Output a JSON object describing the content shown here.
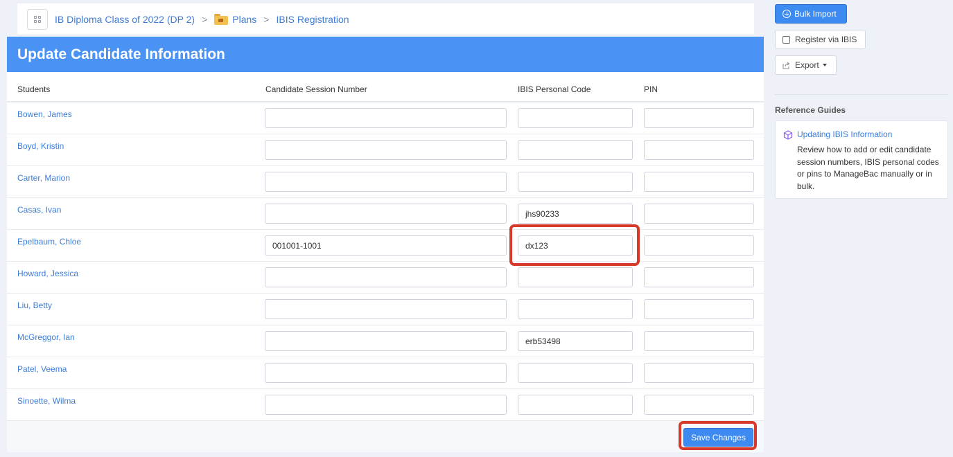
{
  "breadcrumb": {
    "class_name": "IB Diploma Class of 2022 (DP 2)",
    "plans": "Plans",
    "current": "IBIS Registration",
    "separator": ">"
  },
  "panel": {
    "title": "Update Candidate Information",
    "columns": {
      "students": "Students",
      "session": "Candidate Session Number",
      "ibis": "IBIS Personal Code",
      "pin": "PIN"
    },
    "rows": [
      {
        "name": "Bowen, James",
        "session": "",
        "ibis": "",
        "pin": ""
      },
      {
        "name": "Boyd, Kristin",
        "session": "",
        "ibis": "",
        "pin": ""
      },
      {
        "name": "Carter, Marion",
        "session": "",
        "ibis": "",
        "pin": ""
      },
      {
        "name": "Casas, Ivan",
        "session": "",
        "ibis": "jhs90233",
        "pin": ""
      },
      {
        "name": "Epelbaum, Chloe",
        "session": "001001-1001",
        "ibis": "dx123",
        "pin": ""
      },
      {
        "name": "Howard, Jessica",
        "session": "",
        "ibis": "",
        "pin": ""
      },
      {
        "name": "Liu, Betty",
        "session": "",
        "ibis": "",
        "pin": ""
      },
      {
        "name": "McGreggor, Ian",
        "session": "",
        "ibis": "erb53498",
        "pin": ""
      },
      {
        "name": "Patel, Veema",
        "session": "",
        "ibis": "",
        "pin": ""
      },
      {
        "name": "Sinoette, Wilma",
        "session": "",
        "ibis": "",
        "pin": ""
      }
    ],
    "save_label": "Save Changes"
  },
  "sidebar": {
    "bulk_import": "Bulk Import",
    "register_ibis": "Register via IBIS",
    "export": "Export",
    "ref_title": "Reference Guides",
    "ref_link": "Updating IBIS Information",
    "ref_desc": "Review how to add or edit candidate session numbers, IBIS personal codes or pins to ManageBac manually or in bulk."
  },
  "colors": {
    "accent": "#4a93f4",
    "link": "#3d7dd8",
    "highlight": "#d83a2a"
  }
}
